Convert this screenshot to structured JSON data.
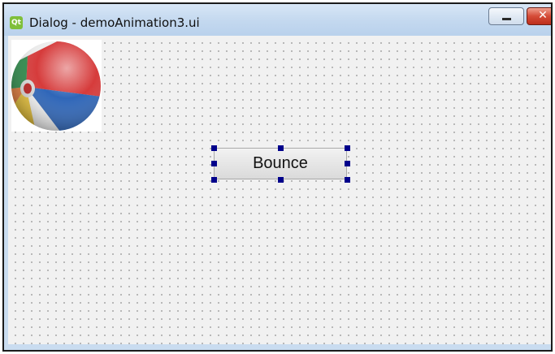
{
  "window": {
    "title": "Dialog - demoAnimation3.ui",
    "app_icon_text": "Qt",
    "app_icon_name": "qt-designer-icon",
    "minimize_icon": "minimize-icon",
    "close_icon": "close-icon",
    "close_glyph": "✕"
  },
  "form": {
    "image_label": "beach-ball-image",
    "push_button": {
      "label": "Bounce",
      "selected": true
    }
  },
  "colors": {
    "title_bar": "#c3d8ef",
    "grid_background": "#f1f1f1",
    "grid_dot": "#9a9a9a",
    "selection_handle": "#00008b",
    "close_button": "#d44b37"
  }
}
